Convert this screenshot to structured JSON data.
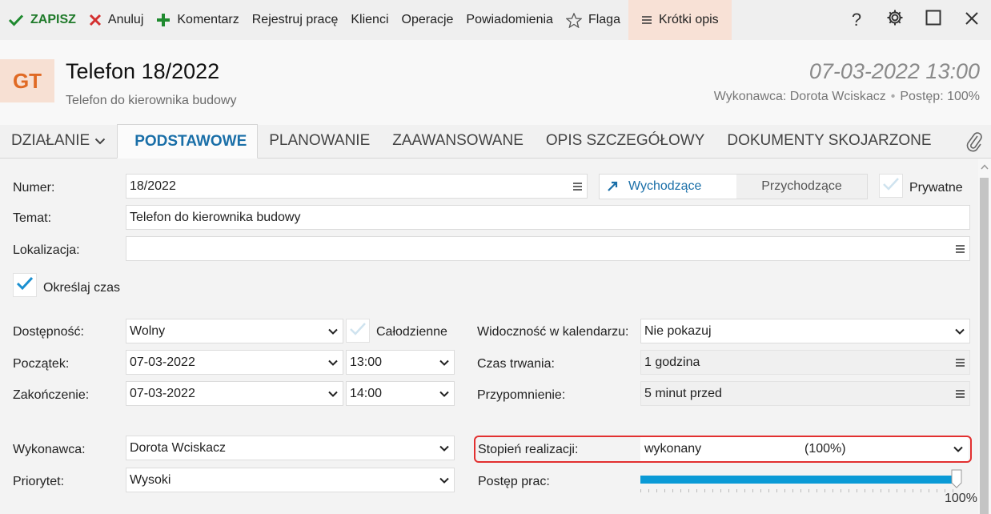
{
  "toolbar": {
    "save": "ZAPISZ",
    "cancel": "Anuluj",
    "comment": "Komentarz",
    "register_work": "Rejestruj pracę",
    "clients": "Klienci",
    "operations": "Operacje",
    "notifications": "Powiadomienia",
    "flag": "Flaga",
    "short_description": "Krótki opis",
    "help": "?"
  },
  "header": {
    "avatar": "GT",
    "title": "Telefon 18/2022",
    "subtitle": "Telefon do kierownika budowy",
    "datetime": "07-03-2022 13:00",
    "assignee": "Wykonawca: Dorota Wciskacz",
    "progress": "Postęp: 100%"
  },
  "tabs": {
    "action": "DZIAŁANIE",
    "items": [
      "PODSTAWOWE",
      "PLANOWANIE",
      "ZAAWANSOWANE",
      "OPIS SZCZEGÓŁOWY",
      "DOKUMENTY SKOJARZONE"
    ],
    "active_index": 0
  },
  "form": {
    "number_label": "Numer:",
    "number_value": "18/2022",
    "direction_out": "Wychodzące",
    "direction_in": "Przychodzące",
    "private_label": "Prywatne",
    "subject_label": "Temat:",
    "subject_value": "Telefon do kierownika budowy",
    "location_label": "Lokalizacja:",
    "location_value": "",
    "specify_time_label": "Określaj czas",
    "availability_label": "Dostępność:",
    "availability_value": "Wolny",
    "all_day_label": "Całodzienne",
    "calendar_visibility_label": "Widoczność w kalendarzu:",
    "calendar_visibility_value": "Nie pokazuj",
    "start_label": "Początek:",
    "start_date": "07-03-2022",
    "start_time": "13:00",
    "duration_label": "Czas trwania:",
    "duration_value": "1 godzina",
    "end_label": "Zakończenie:",
    "end_date": "07-03-2022",
    "end_time": "14:00",
    "reminder_label": "Przypomnienie:",
    "reminder_value": "5 minut przed",
    "assignee_label": "Wykonawca:",
    "assignee_value": "Dorota Wciskacz",
    "completion_label": "Stopień realizacji:",
    "completion_value": "wykonany",
    "completion_pct": "(100%)",
    "priority_label": "Priorytet:",
    "priority_value": "Wysoki",
    "work_progress_label": "Postęp prac:",
    "work_progress_value": 1.0,
    "work_progress_text": "100%"
  },
  "colors": {
    "accent": "#1a6fa8",
    "save_green": "#1f7a2a",
    "cancel_red": "#d32f2f",
    "avatar_bg": "#f7e0d3",
    "avatar_fg": "#e06a24",
    "progress": "#0a9ad6",
    "highlight": "#e23030"
  }
}
